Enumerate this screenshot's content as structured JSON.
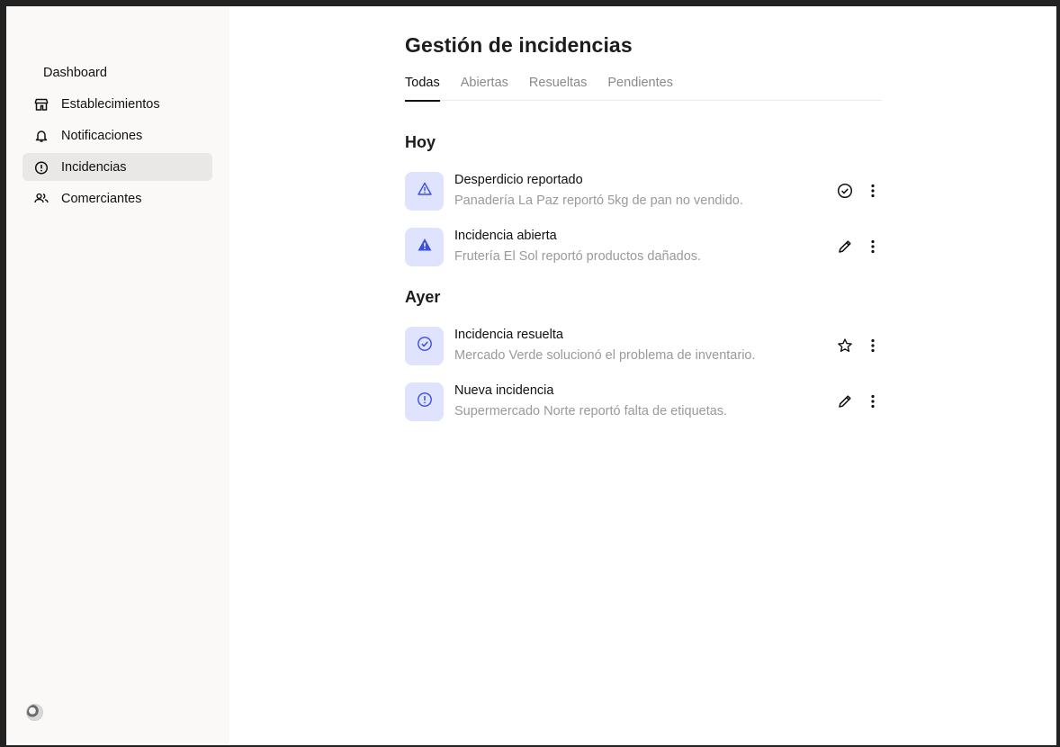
{
  "sidebar": {
    "items": [
      {
        "label": "Dashboard",
        "icon": "none"
      },
      {
        "label": "Establecimientos",
        "icon": "store-icon"
      },
      {
        "label": "Notificaciones",
        "icon": "bell-icon"
      },
      {
        "label": "Incidencias",
        "icon": "alert-circle-icon",
        "active": true
      },
      {
        "label": "Comerciantes",
        "icon": "people-icon"
      }
    ]
  },
  "main": {
    "title": "Gestión de incidencias",
    "tabs": [
      {
        "label": "Todas",
        "active": true
      },
      {
        "label": "Abiertas"
      },
      {
        "label": "Resueltas"
      },
      {
        "label": "Pendientes"
      }
    ],
    "sections": [
      {
        "title": "Hoy",
        "items": [
          {
            "title": "Desperdicio reportado",
            "subtitle": "Panadería La Paz reportó 5kg de pan no vendido.",
            "icon": "warning-outline-icon",
            "action_icon": "check-circle-icon"
          },
          {
            "title": "Incidencia abierta",
            "subtitle": "Frutería El Sol reportó productos dañados.",
            "icon": "warning-filled-icon",
            "action_icon": "pencil-icon"
          }
        ]
      },
      {
        "title": "Ayer",
        "items": [
          {
            "title": "Incidencia resuelta",
            "subtitle": "Mercado Verde solucionó el problema de inventario.",
            "icon": "check-circle-icon",
            "action_icon": "star-icon"
          },
          {
            "title": "Nueva incidencia",
            "subtitle": "Supermercado Norte reportó falta de etiquetas.",
            "icon": "alert-circle-icon",
            "action_icon": "pencil-icon"
          }
        ]
      }
    ]
  },
  "colors": {
    "accent": "#3b4fe0",
    "badge_bg": "#dfe3fd",
    "sidebar_bg": "#faf9f7",
    "active_nav_bg": "#e9e8e6"
  }
}
